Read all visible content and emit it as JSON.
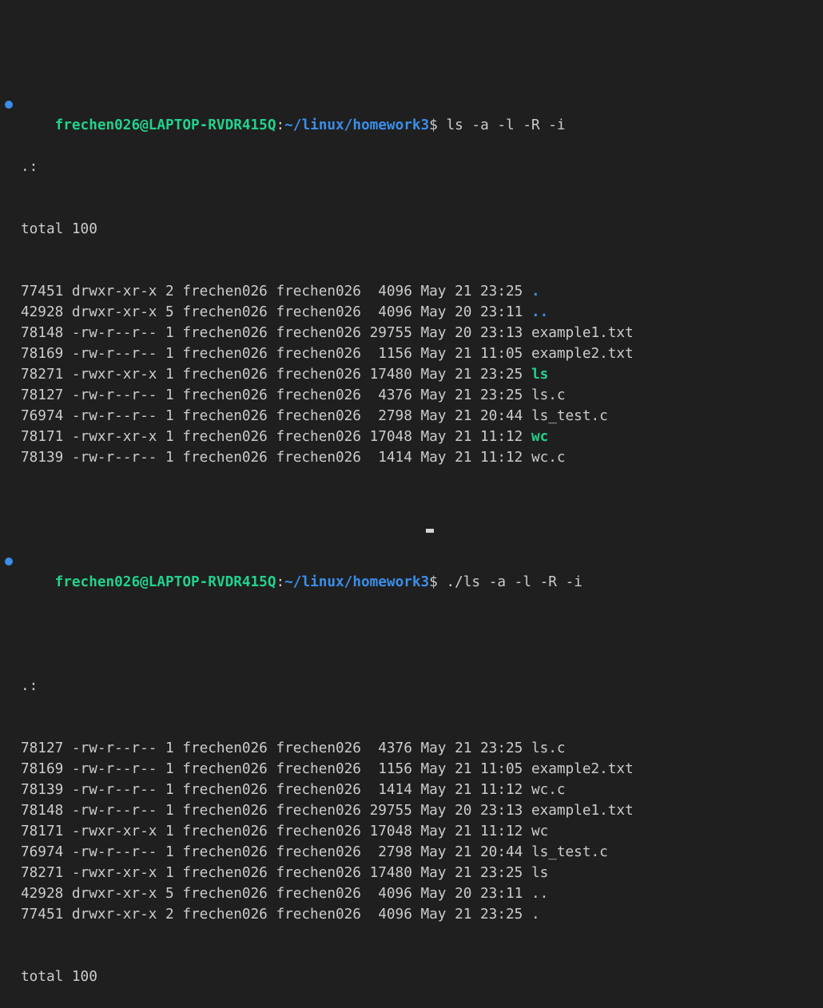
{
  "colors": {
    "background": "#1f1f1f",
    "text": "#cccccc",
    "user": "#23d18b",
    "path": "#3b8eea",
    "dir": "#3b8eea",
    "exec": "#23d18b",
    "prompt_dot": "#3b8eea"
  },
  "prompt": {
    "user_host": "frechen026@LAPTOP-RVDR415Q",
    "sep": ":",
    "path": "~/linux/homework3",
    "symbol": "$ "
  },
  "session1": {
    "command": "ls -a -l -R -i",
    "header": ".:",
    "total": "total 100",
    "rows": [
      {
        "meta": "77451 drwxr-xr-x 2 frechen026 frechen026  4096 May 21 23:25 ",
        "name": ".",
        "kind": "dir"
      },
      {
        "meta": "42928 drwxr-xr-x 5 frechen026 frechen026  4096 May 20 23:11 ",
        "name": "..",
        "kind": "dir"
      },
      {
        "meta": "78148 -rw-r--r-- 1 frechen026 frechen026 29755 May 20 23:13 ",
        "name": "example1.txt",
        "kind": "file"
      },
      {
        "meta": "78169 -rw-r--r-- 1 frechen026 frechen026  1156 May 21 11:05 ",
        "name": "example2.txt",
        "kind": "file"
      },
      {
        "meta": "78271 -rwxr-xr-x 1 frechen026 frechen026 17480 May 21 23:25 ",
        "name": "ls",
        "kind": "exec"
      },
      {
        "meta": "78127 -rw-r--r-- 1 frechen026 frechen026  4376 May 21 23:25 ",
        "name": "ls.c",
        "kind": "file"
      },
      {
        "meta": "76974 -rw-r--r-- 1 frechen026 frechen026  2798 May 21 20:44 ",
        "name": "ls_test.c",
        "kind": "file"
      },
      {
        "meta": "78171 -rwxr-xr-x 1 frechen026 frechen026 17048 May 21 11:12 ",
        "name": "wc",
        "kind": "exec"
      },
      {
        "meta": "78139 -rw-r--r-- 1 frechen026 frechen026  1414 May 21 11:12 ",
        "name": "wc.c",
        "kind": "file"
      }
    ]
  },
  "session2": {
    "command": "./ls -a -l -R -i",
    "header": ".:",
    "rows": [
      {
        "meta": "78127 -rw-r--r-- 1 frechen026 frechen026  4376 May 21 23:25 ",
        "name": "ls.c",
        "kind": "file"
      },
      {
        "meta": "78169 -rw-r--r-- 1 frechen026 frechen026  1156 May 21 11:05 ",
        "name": "example2.txt",
        "kind": "file"
      },
      {
        "meta": "78139 -rw-r--r-- 1 frechen026 frechen026  1414 May 21 11:12 ",
        "name": "wc.c",
        "kind": "file"
      },
      {
        "meta": "78148 -rw-r--r-- 1 frechen026 frechen026 29755 May 20 23:13 ",
        "name": "example1.txt",
        "kind": "file"
      },
      {
        "meta": "78171 -rwxr-xr-x 1 frechen026 frechen026 17048 May 21 11:12 ",
        "name": "wc",
        "kind": "file"
      },
      {
        "meta": "76974 -rw-r--r-- 1 frechen026 frechen026  2798 May 21 20:44 ",
        "name": "ls_test.c",
        "kind": "file"
      },
      {
        "meta": "78271 -rwxr-xr-x 1 frechen026 frechen026 17480 May 21 23:25 ",
        "name": "ls",
        "kind": "file"
      },
      {
        "meta": "42928 drwxr-xr-x 5 frechen026 frechen026  4096 May 20 23:11 ",
        "name": "..",
        "kind": "file"
      },
      {
        "meta": "77451 drwxr-xr-x 2 frechen026 frechen026  4096 May 21 23:25 ",
        "name": ".",
        "kind": "file"
      }
    ],
    "total": "total 100"
  }
}
